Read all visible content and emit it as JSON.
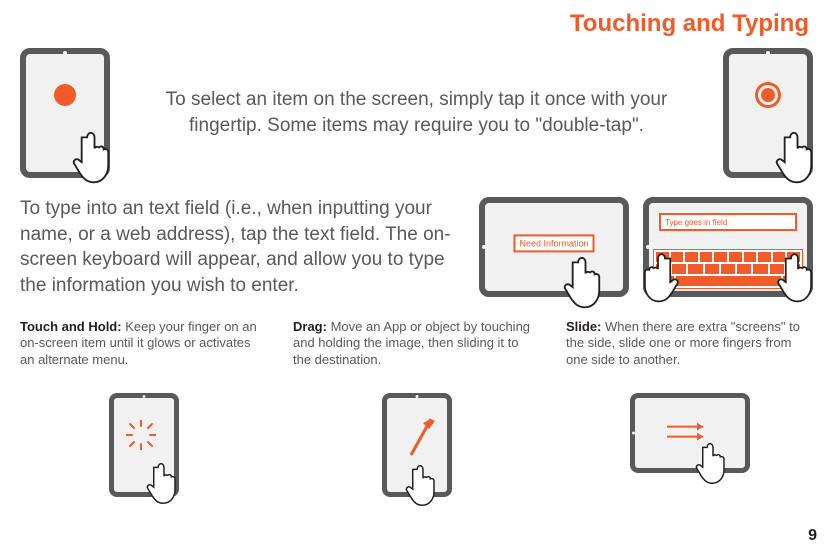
{
  "title": "Touching and Typing",
  "tap_intro": "To select an item on the screen, simply tap it once with your fingertip.  Some items may require you to \"double-tap\".",
  "type_intro": "To type into an text field (i.e., when inputting your name, or a web address), tap the text field.  The on-screen keyboard will appear, and allow you to type the information you wish to enter.",
  "need_info_label": "Need Information",
  "field_label": "Type goes in field",
  "gestures": {
    "touch_hold": {
      "label": "Touch and Hold:",
      "desc": " Keep your finger on an on-screen item until it glows or activates an alternate menu."
    },
    "drag": {
      "label": "Drag:",
      "desc": " Move an App or object by touching and holding the image, then sliding it to the destination."
    },
    "slide": {
      "label": "Slide:",
      "desc": " When there are extra \"screens\" to the side, slide one or more fingers from one side to another."
    }
  },
  "page_number": "9"
}
